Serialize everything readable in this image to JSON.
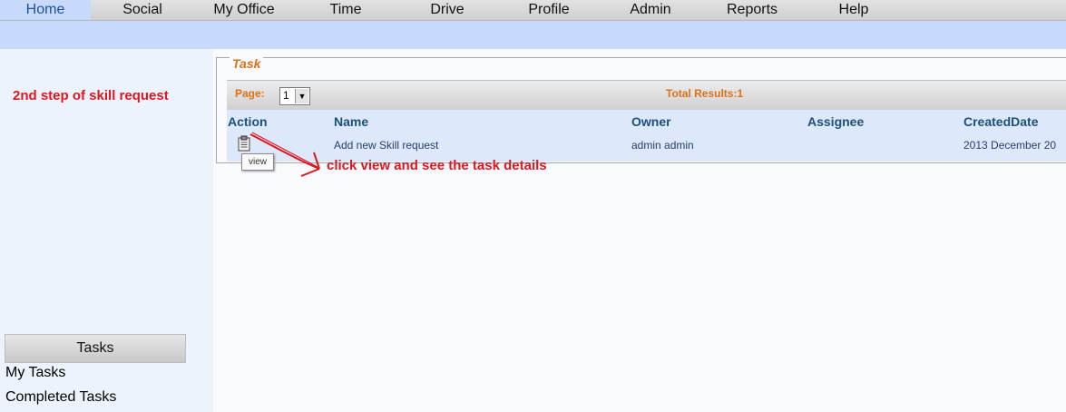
{
  "nav": {
    "items": [
      "Home",
      "Social",
      "My Office",
      "Time",
      "Drive",
      "Profile",
      "Admin",
      "Reports",
      "Help"
    ],
    "active": "Home"
  },
  "sidebar": {
    "note": "2nd step of skill request",
    "tasks_header": "Tasks",
    "links": [
      "My Tasks",
      "Completed Tasks"
    ]
  },
  "task_panel": {
    "legend": "Task",
    "page_label": "Page:",
    "page_value": "1",
    "total_results": "Total Results:1",
    "columns": [
      "Action",
      "Name",
      "Owner",
      "Assignee",
      "CreatedDate"
    ],
    "rows": [
      {
        "action_icon": "clipboard-icon",
        "name": "Add new Skill request",
        "owner": "admin admin",
        "assignee": "",
        "created": "2013 December 20"
      }
    ],
    "tooltip": "view"
  },
  "annotation": {
    "text": "click view and see the task details",
    "color": "#e0161e"
  },
  "colors": {
    "accent_orange": "#e07018",
    "header_blue": "#1d4f7a",
    "bar_blue": "#c8dafc"
  }
}
